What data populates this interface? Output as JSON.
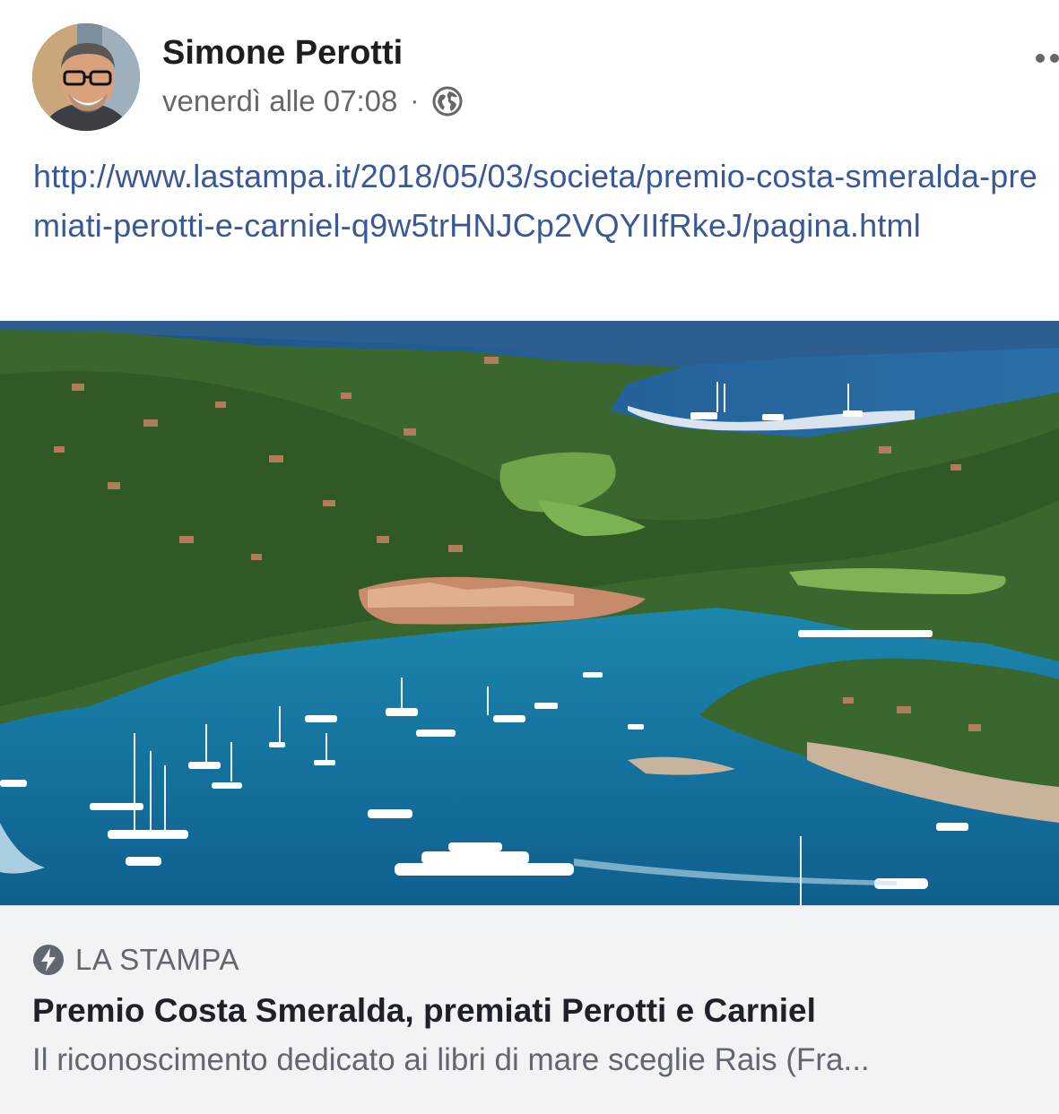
{
  "post": {
    "author_name": "Simone Perotti",
    "timestamp": "venerdì alle 07:08",
    "separator": "·",
    "privacy_icon": "globe-icon",
    "more_icon": "more-options-icon",
    "link_text": "http://www.lastampa.it/2018/05/03/societa/premio-costa-smeralda-premiati-perotti-e-carniel-q9w5trHNJCp2VQYIIfRkeJ/pagina.html"
  },
  "link_preview": {
    "source_icon": "instant-article-bolt-icon",
    "source": "LA STAMPA",
    "title": "Premio Costa Smeralda, premiati Perotti e Carniel",
    "description": "Il riconoscimento dedicato ai libri di mare sceglie Rais (Fra..."
  },
  "colors": {
    "link": "#385898",
    "meta_text": "#65676b",
    "footer_bg": "#f2f3f5",
    "sea": "#1e8fb5",
    "land": "#3d6a2f"
  }
}
